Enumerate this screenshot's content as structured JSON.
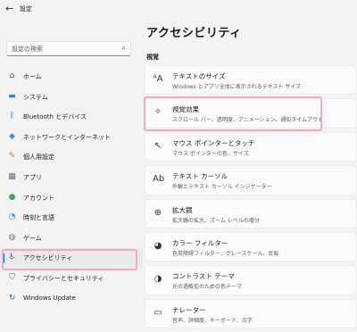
{
  "window": {
    "title": "設定"
  },
  "search": {
    "placeholder": "設定の検索"
  },
  "sidebar": {
    "items": [
      {
        "label": "ホーム",
        "icon": "home-icon",
        "glyph": "⌂",
        "color": "#4a4a4a"
      },
      {
        "label": "システム",
        "icon": "monitor-icon",
        "glyph": "▬",
        "color": "#2a7fd4"
      },
      {
        "label": "Bluetooth とデバイス",
        "icon": "bluetooth-icon",
        "glyph": "ᛒ",
        "color": "#1f6fd0"
      },
      {
        "label": "ネットワークとインターネット",
        "icon": "wifi-icon",
        "glyph": "◆",
        "color": "#3c8dde"
      },
      {
        "label": "個人用設定",
        "icon": "brush-icon",
        "glyph": "✎",
        "color": "#c07a2f"
      },
      {
        "label": "アプリ",
        "icon": "apps-icon",
        "glyph": "▦",
        "color": "#5a6a8a"
      },
      {
        "label": "アカウント",
        "icon": "person-icon",
        "glyph": "●",
        "color": "#2fae5b"
      },
      {
        "label": "時刻と言語",
        "icon": "globe-clock-icon",
        "glyph": "◔",
        "color": "#2a8fd4"
      },
      {
        "label": "ゲーム",
        "icon": "gamepad-icon",
        "glyph": "◍",
        "color": "#7a7a7a"
      },
      {
        "label": "アクセシビリティ",
        "icon": "accessibility-icon",
        "glyph": "♿",
        "color": "#1f6fd0",
        "active": true
      },
      {
        "label": "プライバシーとセキュリティ",
        "icon": "shield-icon",
        "glyph": "⛉",
        "color": "#6a6a6a"
      },
      {
        "label": "Windows Update",
        "icon": "update-icon",
        "glyph": "↻",
        "color": "#1f6fd0"
      }
    ]
  },
  "main": {
    "title": "アクセシビリティ",
    "section": "視覚",
    "cards": [
      {
        "title": "テキストのサイズ",
        "desc": "Windows とアプリ全体に表示されるテキスト サイズ",
        "icon": "text-size-icon",
        "glyph": "ᴬA"
      },
      {
        "title": "視覚効果",
        "desc": "スクロール バー、透明度、アニメーション、通知タイムアウト",
        "icon": "sparkle-icon",
        "glyph": "✧"
      },
      {
        "title": "マウス ポインターとタッチ",
        "desc": "マウス ポインターの色、サイズ",
        "icon": "pointer-icon",
        "glyph": "↖"
      },
      {
        "title": "テキスト カーソル",
        "desc": "外観とテキスト カーソル インジケーター",
        "icon": "text-cursor-icon",
        "glyph": "Ab"
      },
      {
        "title": "拡大鏡",
        "desc": "拡大鏡の拡大、ズーム レベルの増分",
        "icon": "magnifier-icon",
        "glyph": "⊕"
      },
      {
        "title": "カラー フィルター",
        "desc": "色覚障碍フィルター、グレースケール、反転",
        "icon": "color-filter-icon",
        "glyph": "◕"
      },
      {
        "title": "コントラスト テーマ",
        "desc": "光の過敏症のための色テーマ",
        "icon": "contrast-icon",
        "glyph": "◑"
      },
      {
        "title": "ナレーター",
        "desc": "音声、詳細度、キーボード、点字",
        "icon": "narrator-icon",
        "glyph": "▭"
      }
    ]
  }
}
